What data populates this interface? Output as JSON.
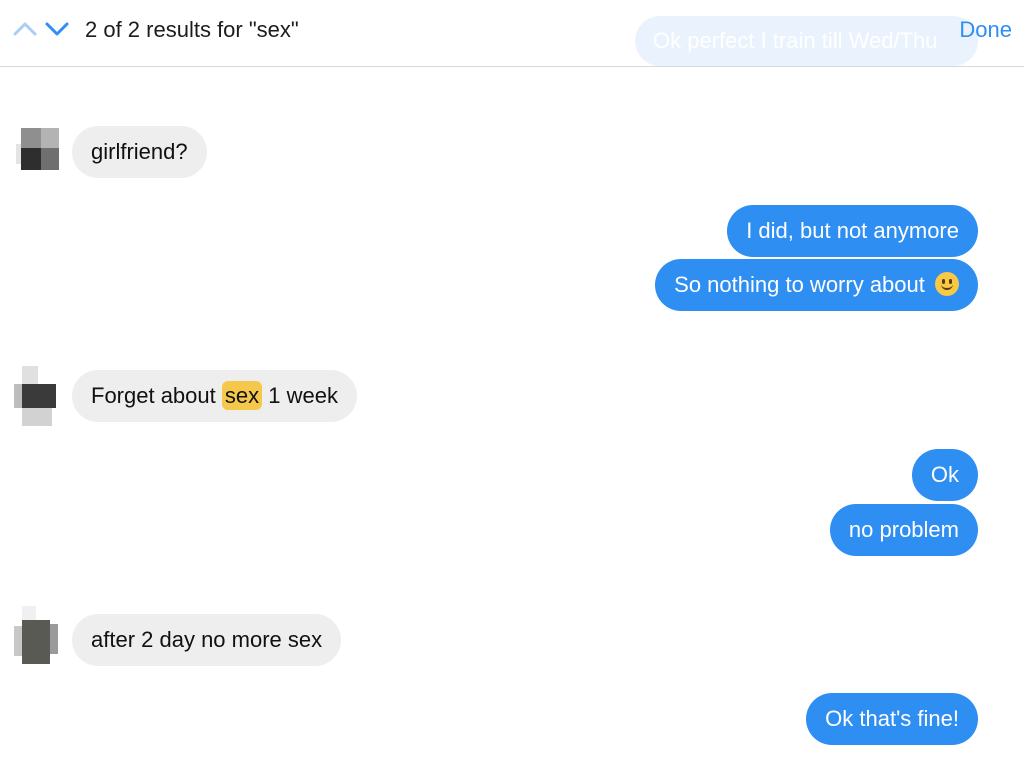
{
  "search_bar": {
    "results_text": "2 of 2 results for \"sex\"",
    "done_label": "Done",
    "prev_icon": "chevron-up-icon",
    "next_icon": "chevron-down-icon",
    "behind_bubble_text": "Ok perfect I train till Wed/Thu"
  },
  "colors": {
    "accent": "#2f8ef2",
    "incoming_bubble": "#eeeeee",
    "highlight": "#f5c84b"
  },
  "messages": [
    {
      "direction": "incoming",
      "text": "girlfriend?"
    },
    {
      "direction": "outgoing",
      "text": "I did, but not anymore"
    },
    {
      "direction": "outgoing",
      "text": "So nothing to worry about",
      "emoji": "slightly-smiling-face-icon"
    },
    {
      "direction": "incoming",
      "text_before": "Forget about",
      "highlight": "sex",
      "text_after": "1 week"
    },
    {
      "direction": "outgoing",
      "text": "Ok"
    },
    {
      "direction": "outgoing",
      "text": "no problem"
    },
    {
      "direction": "incoming",
      "text": "after 2 day no more sex"
    },
    {
      "direction": "outgoing",
      "text": "Ok that's fine!"
    }
  ]
}
